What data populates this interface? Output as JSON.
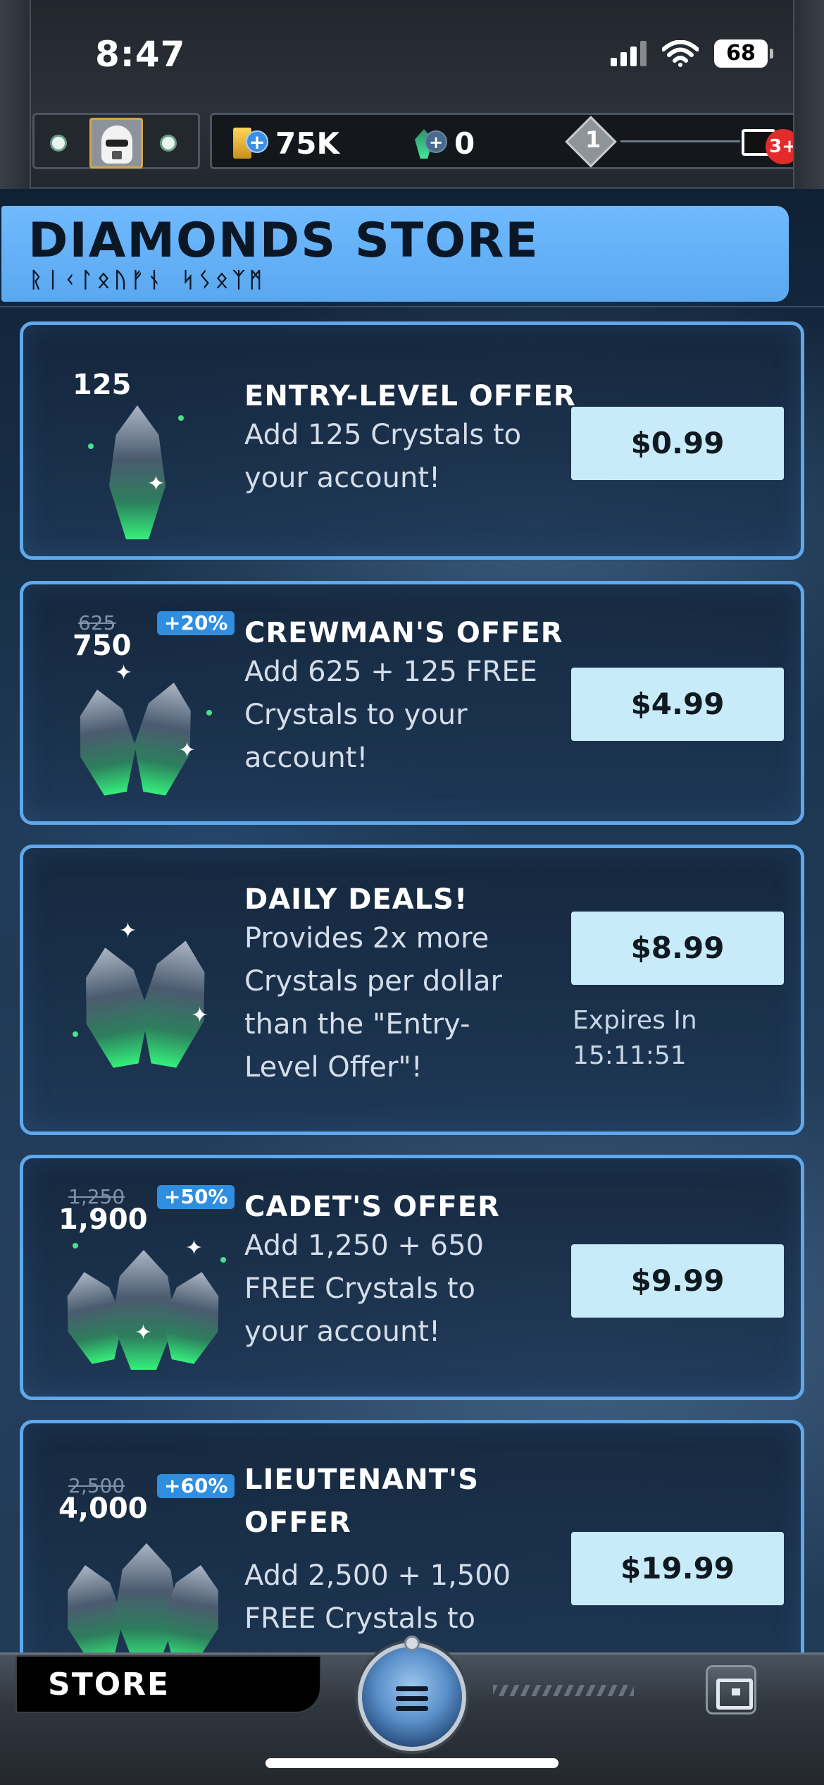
{
  "status_bar": {
    "time": "8:47",
    "battery": "68"
  },
  "hud": {
    "credits": "75K",
    "crystals": "0",
    "rank": "1",
    "notifications": "3+"
  },
  "header": {
    "title": "DIAMONDS STORE",
    "subtitle_aurebesh": "ᚱᛁᚲᛚᛟᚢᚠᚾ ᛋᛊᛟᛉᛗ"
  },
  "offers": [
    {
      "amount": "125",
      "title": "ENTRY-LEVEL OFFER",
      "description": "Add 125 Crystals to\nyour account!",
      "price": "$0.99"
    },
    {
      "old_amount": "625",
      "amount": "750",
      "bonus": "+20%",
      "title": "CREWMAN'S OFFER",
      "description": "Add 625 + 125 FREE\nCrystals to your\naccount!",
      "price": "$4.99"
    },
    {
      "title": "DAILY DEALS!",
      "description": "Provides 2x more\nCrystals per dollar\nthan the \"Entry-\nLevel Offer\"!",
      "price": "$8.99",
      "expires_label": "Expires In",
      "expires_time": "15:11:51"
    },
    {
      "old_amount": "1,250",
      "amount": "1,900",
      "bonus": "+50%",
      "title": "CADET'S OFFER",
      "description": "Add 1,250 + 650\nFREE Crystals to\nyour account!",
      "price": "$9.99"
    },
    {
      "old_amount": "2,500",
      "amount": "4,000",
      "bonus": "+60%",
      "title": "LIEUTENANT'S\nOFFER",
      "description": "Add 2,500 + 1,500\nFREE Crystals to",
      "price": "$19.99"
    }
  ],
  "bottom_nav": {
    "store_label": "STORE",
    "menu_icon": "hamburger-icon",
    "calendar_icon": "calendar-icon"
  },
  "colors": {
    "accent": "#5fa8ec",
    "header_bg": "#70baff",
    "price_button": "#c8ebfa",
    "bonus_badge": "#2f8ee0",
    "notification": "#e32b2b"
  }
}
